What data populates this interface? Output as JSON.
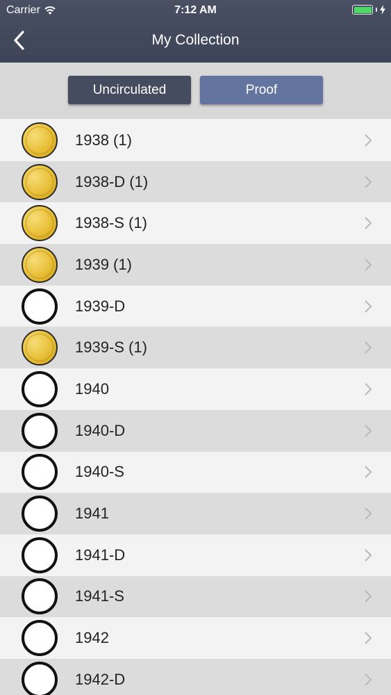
{
  "status": {
    "carrier": "Carrier",
    "time": "7:12 AM"
  },
  "nav": {
    "title": "My Collection"
  },
  "segments": [
    {
      "label": "Uncirculated"
    },
    {
      "label": "Proof"
    }
  ],
  "rows": [
    {
      "label": "1938 (1)",
      "owned": true
    },
    {
      "label": "1938-D (1)",
      "owned": true
    },
    {
      "label": "1938-S (1)",
      "owned": true
    },
    {
      "label": "1939 (1)",
      "owned": true
    },
    {
      "label": "1939-D",
      "owned": false
    },
    {
      "label": "1939-S (1)",
      "owned": true
    },
    {
      "label": "1940",
      "owned": false
    },
    {
      "label": "1940-D",
      "owned": false
    },
    {
      "label": "1940-S",
      "owned": false
    },
    {
      "label": "1941",
      "owned": false
    },
    {
      "label": "1941-D",
      "owned": false
    },
    {
      "label": "1941-S",
      "owned": false
    },
    {
      "label": "1942",
      "owned": false
    },
    {
      "label": "1942-D",
      "owned": false
    }
  ]
}
